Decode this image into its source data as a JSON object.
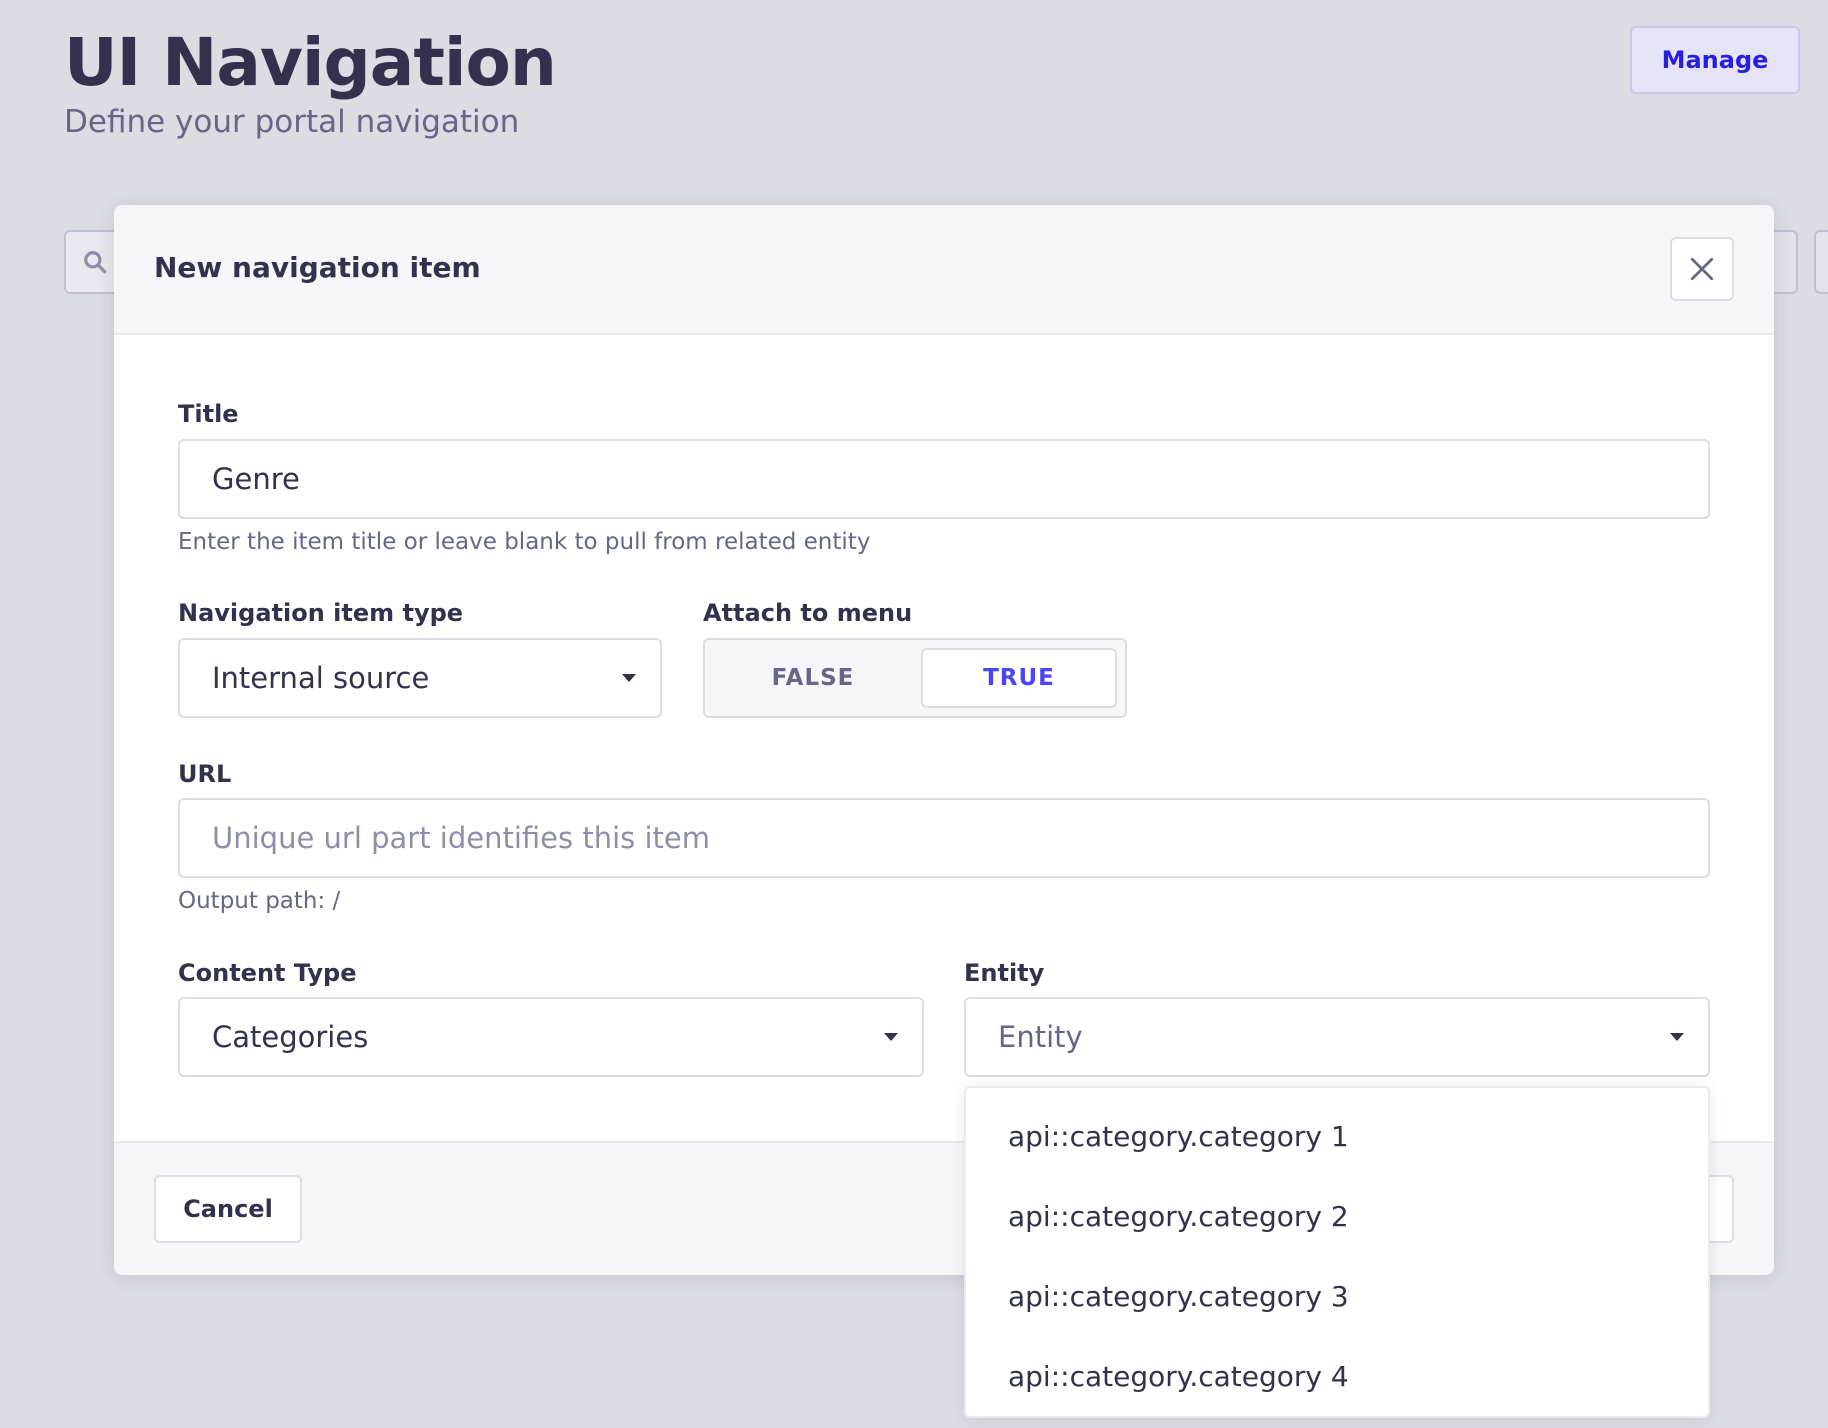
{
  "page": {
    "title": "UI Navigation",
    "subtitle": "Define your portal navigation",
    "manage_label": "Manage"
  },
  "modal": {
    "title": "New navigation item",
    "title_field": {
      "label": "Title",
      "value": "Genre",
      "hint": "Enter the item title or leave blank to pull from related entity"
    },
    "type_field": {
      "label": "Navigation item type",
      "value": "Internal source"
    },
    "attach_field": {
      "label": "Attach to menu",
      "false_label": "FALSE",
      "true_label": "TRUE",
      "selected": "TRUE"
    },
    "url_field": {
      "label": "URL",
      "placeholder": "Unique url part identifies this item",
      "value": "",
      "hint": "Output path: /"
    },
    "content_type_field": {
      "label": "Content Type",
      "value": "Categories"
    },
    "entity_field": {
      "label": "Entity",
      "placeholder": "Entity",
      "options": [
        "api::category.category 1",
        "api::category.category 2",
        "api::category.category 3",
        "api::category.category 4"
      ]
    },
    "cancel_label": "Cancel"
  },
  "colors": {
    "primary": "#4945ff",
    "text": "#32324d",
    "muted": "#666687",
    "overlay": "#dcdde3"
  }
}
